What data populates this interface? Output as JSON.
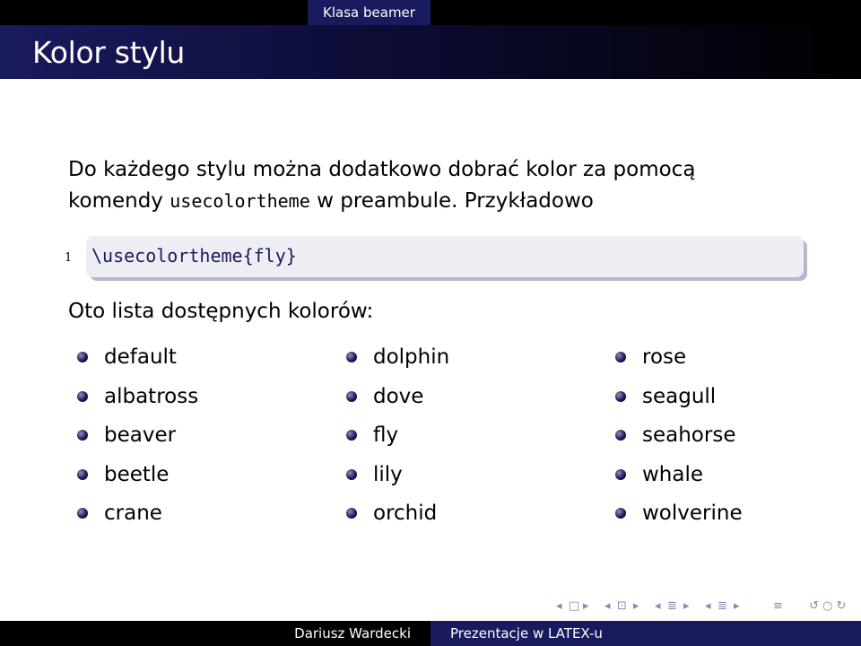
{
  "headline": {
    "section": "Klasa beamer"
  },
  "frame_title": "Kolor stylu",
  "paragraph": {
    "line1": "Do każdego stylu można dodatkowo dobrać kolor za pomocą",
    "line2_before": "komendy ",
    "line2_code": "usecolortheme",
    "line2_after": " w preambule. Przykładowo"
  },
  "code_listing": {
    "line_number": "1",
    "code": "\\usecolortheme{fly}"
  },
  "intro": "Oto lista dostępnych kolorów:",
  "color_themes": {
    "col1": [
      "default",
      "albatross",
      "beaver",
      "beetle",
      "crane"
    ],
    "col2": [
      "dolphin",
      "dove",
      "fly",
      "lily",
      "orchid"
    ],
    "col3": [
      "rose",
      "seagull",
      "seahorse",
      "whale",
      "wolverine"
    ]
  },
  "navigation": {
    "frame_prev": "◂",
    "frame": "□",
    "frame_next": "▸",
    "subsection_prev": "◂",
    "subsection": "⊡",
    "subsection_next": "▸",
    "section_prev": "◂",
    "section": "≣",
    "section_next": "▸",
    "doc_prev": "◂",
    "doc": "≣",
    "doc_next": "▸",
    "align": "≡",
    "search": "↺ ○ ↻"
  },
  "footer": {
    "author": "Dariusz Wardecki",
    "title": "Prezentacje w LATEX-u"
  },
  "colors": {
    "primary": "#1a1a5e",
    "bar": "#000000",
    "listing_bg": "#ededf4"
  }
}
